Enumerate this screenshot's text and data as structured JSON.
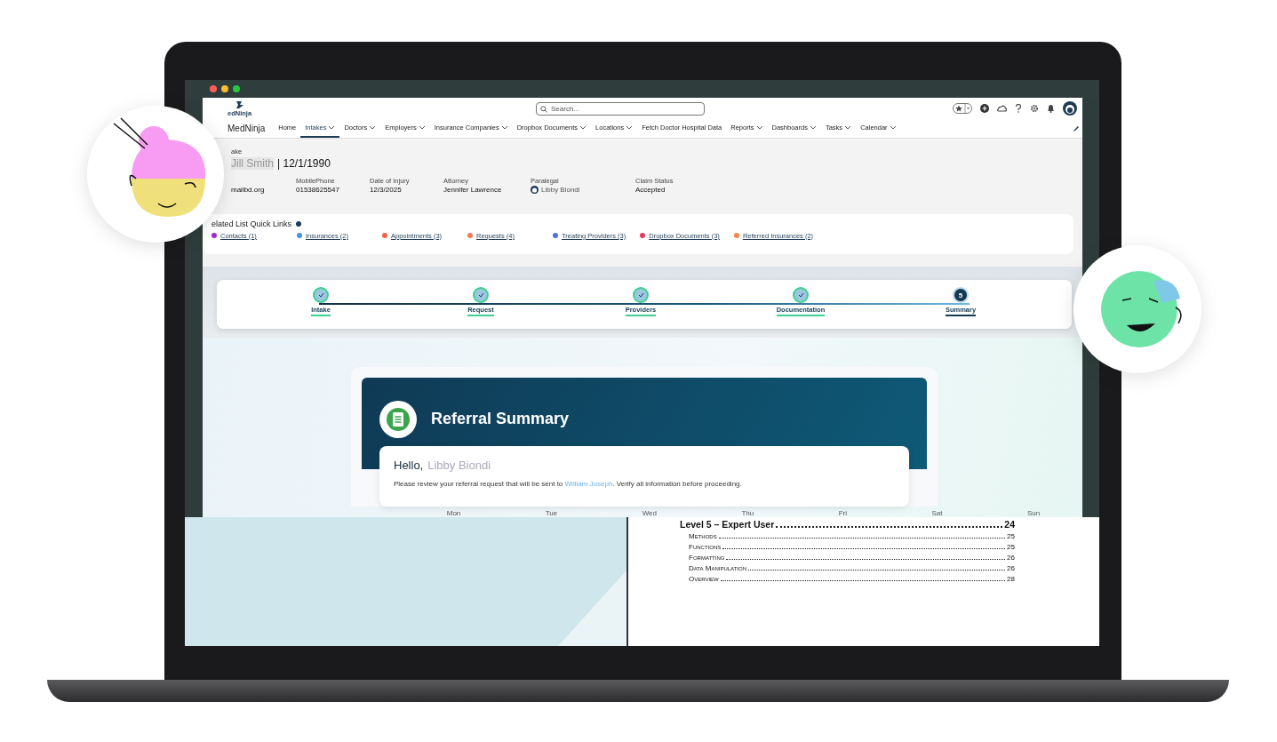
{
  "app": {
    "logo_text": "edNinja",
    "brand": "MedNinja",
    "search": {
      "placeholder": "Search..."
    },
    "nav": [
      {
        "label": "Home",
        "selected": false,
        "dropdown": false
      },
      {
        "label": "Intakes",
        "selected": true,
        "dropdown": true
      },
      {
        "label": "Doctors",
        "selected": false,
        "dropdown": true
      },
      {
        "label": "Employers",
        "selected": false,
        "dropdown": true
      },
      {
        "label": "Insurance Companies",
        "selected": false,
        "dropdown": true
      },
      {
        "label": "Dropbox Documents",
        "selected": false,
        "dropdown": true
      },
      {
        "label": "Locations",
        "selected": false,
        "dropdown": true
      },
      {
        "label": "Fetch Doctor Hospital Data",
        "selected": false,
        "dropdown": false
      },
      {
        "label": "Reports",
        "selected": false,
        "dropdown": true
      },
      {
        "label": "Dashboards",
        "selected": false,
        "dropdown": true
      },
      {
        "label": "Tasks",
        "selected": false,
        "dropdown": true
      },
      {
        "label": "Calendar",
        "selected": false,
        "dropdown": true
      }
    ]
  },
  "record": {
    "object_label": "ake",
    "name": "Jill Smith",
    "date": "| 12/1/1990",
    "fields": [
      {
        "kind": "plain",
        "value": "mailbd.org"
      },
      {
        "kind": "plain",
        "label": "MobilePhone",
        "value": "01538625547"
      },
      {
        "kind": "plain",
        "label": "Date of Injury",
        "value": "12/3/2025"
      },
      {
        "kind": "plain",
        "label": "Attorney",
        "value": "Jennifer Lawrence"
      },
      {
        "kind": "user",
        "label": "Paralegal",
        "value": "Libby Biondi"
      },
      {
        "kind": "plain",
        "label": "Claim Status",
        "value": "Accepted"
      }
    ]
  },
  "quick_links": {
    "title": "elated List Quick Links",
    "items": [
      {
        "label": "Contacts (1)",
        "color": "#9b2fc9"
      },
      {
        "label": "Insurances (2)",
        "color": "#4a90e2"
      },
      {
        "label": "Appointments (3)",
        "color": "#e8674a"
      },
      {
        "label": "Requests (4)",
        "color": "#f07c54"
      },
      {
        "label": "Treating Providers (3)",
        "color": "#4f6fe0"
      },
      {
        "label": "Dropbox Documents (3)",
        "color": "#e8385f"
      },
      {
        "label": "Referred Insurances (2)",
        "color": "#f08a4b"
      }
    ]
  },
  "progress": {
    "steps": [
      {
        "label": "Intake",
        "done": true
      },
      {
        "label": "Request",
        "done": true
      },
      {
        "label": "Providers",
        "done": true
      },
      {
        "label": "Documentation",
        "done": true
      },
      {
        "label": "Summary",
        "done": false,
        "number": "5"
      }
    ]
  },
  "summary": {
    "title": "Referral Summary",
    "greeting": "Hello,",
    "greeting_name": "Libby Biondi",
    "message_before": "Please review your referral request that will be sent to ",
    "recipient": "William Joseph",
    "message_after": ". Verify all information before proceeding."
  },
  "weekdays": [
    "Mon",
    "Tue",
    "Wed",
    "Thu",
    "Fri",
    "Sat",
    "Sun"
  ],
  "document": {
    "heading": "Level 5 – Expert User",
    "page": "24",
    "entries": [
      {
        "title": "Methods",
        "page": "25"
      },
      {
        "title": "Functions",
        "page": "25"
      },
      {
        "title": "Formatting",
        "page": "26"
      },
      {
        "title": "Data Manipulation",
        "page": "26"
      },
      {
        "title": "Overview",
        "page": "28"
      }
    ]
  }
}
